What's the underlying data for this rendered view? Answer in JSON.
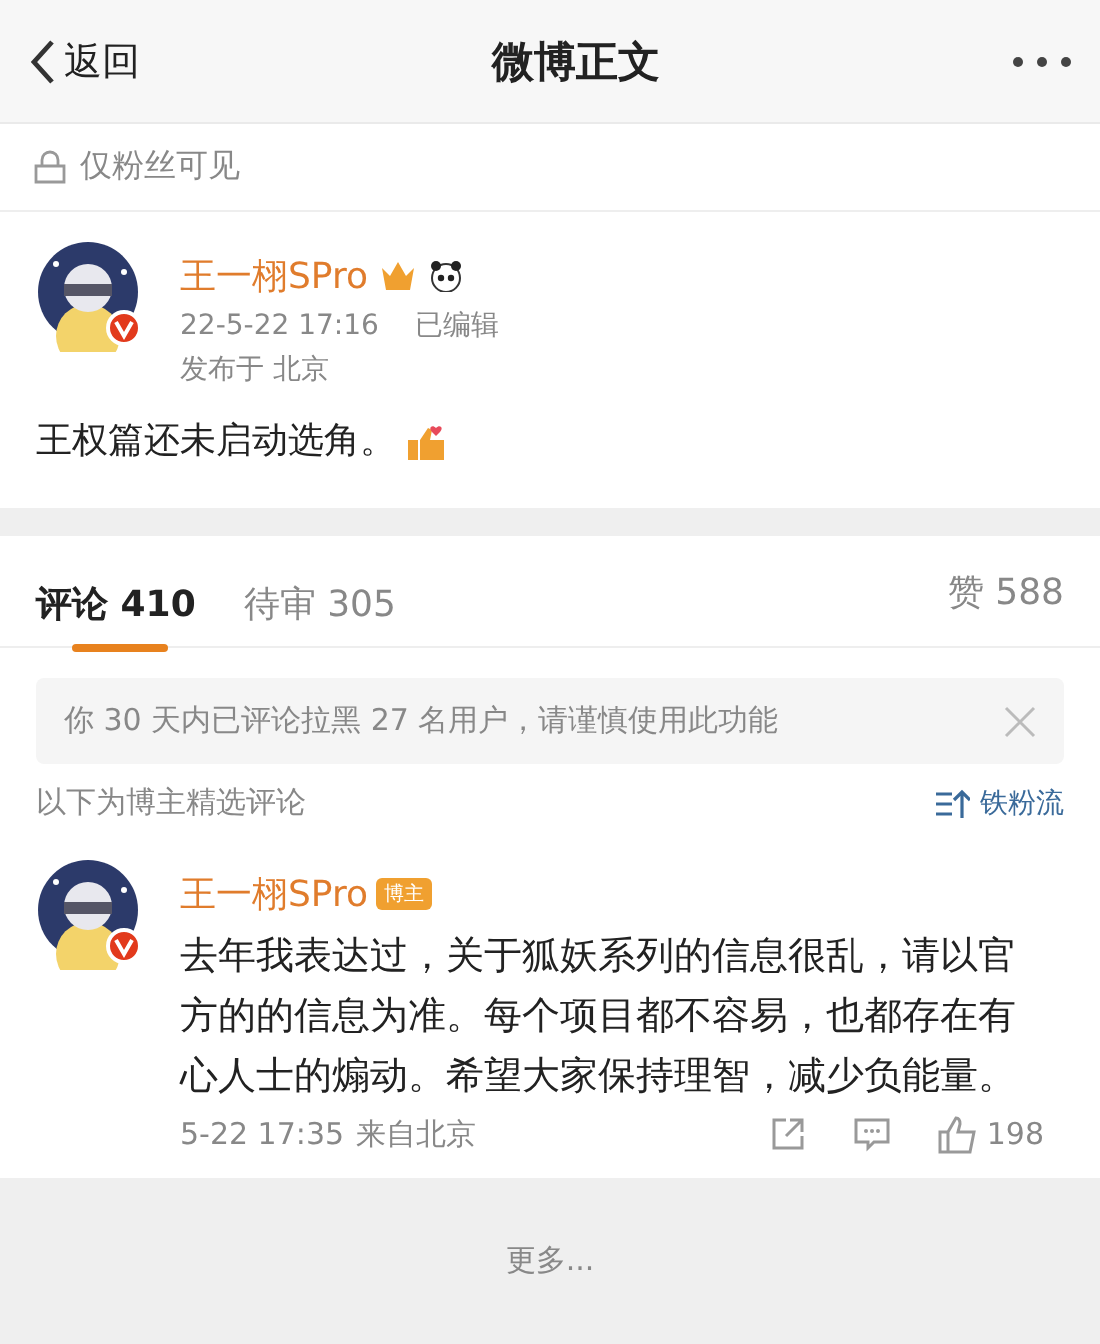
{
  "nav": {
    "back": "返回",
    "title": "微博正文"
  },
  "visibility": "仅粉丝可见",
  "post": {
    "author": "王一栩SPro",
    "time": "22-5-22 17:16",
    "edited": "已编辑",
    "location": "发布于 北京",
    "text": "王权篇还未启动选角。",
    "verified": true
  },
  "tabs": [
    {
      "label": "评论",
      "count": "410",
      "selected": true
    },
    {
      "label": "待审",
      "count": "305",
      "selected": false
    }
  ],
  "likes": {
    "label": "赞",
    "count": "588"
  },
  "notice": "你 30 天内已评论拉黑 27 名用户，请谨慎使用此功能",
  "section": {
    "caption": "以下为博主精选评论",
    "sort": "铁粉流"
  },
  "comments": [
    {
      "author": "王一栩SPro",
      "badge": "博主",
      "text": "去年我表达过，关于狐妖系列的信息很乱，请以官方的的信息为准。每个项目都不容易，也都存在有心人士的煽动。希望大家保持理智，减少负能量。",
      "time": "5-22 17:35",
      "location": "来自北京",
      "likes": "198",
      "verified": true
    }
  ],
  "more": "更多..."
}
